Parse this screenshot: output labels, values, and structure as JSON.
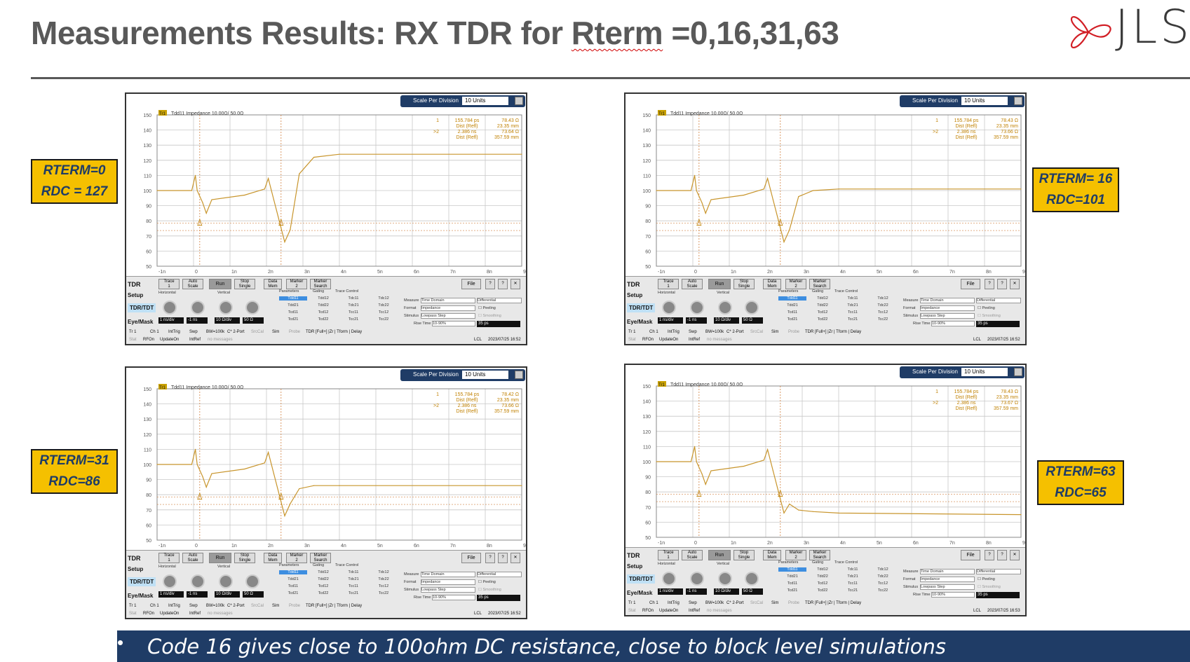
{
  "slide": {
    "title_prefix": "Measurements Results: RX TDR for ",
    "title_rterm": "Rterm",
    "title_suffix": " =0,16,31,63",
    "logo_text": "JLSe",
    "bullet": "•",
    "footer": "Code 16 gives close to 100ohm DC resistance, close to block level simulations"
  },
  "labels": [
    {
      "line1": "RTERM=0",
      "line2": "RDC = 127"
    },
    {
      "line1": "RTERM= 16",
      "line2": "RDC=101"
    },
    {
      "line1": "RTERM=31",
      "line2": "RDC=86"
    },
    {
      "line1": "RTERM=63",
      "line2": "RDC=65"
    }
  ],
  "panel_common": {
    "scale_label": "Scale Per Division",
    "scale_value": "10 Units",
    "trace_label": "Tr1",
    "trace_title": "Tdd11 Impedance 10.00Ω/  50.0Ω",
    "mk1": "1",
    "mk2": ">2",
    "mk1_t": "155.784  ps",
    "mk_dist": "Dist (Refl)",
    "mk1_d": "23.35 mm",
    "mk2_t": "2.386  ns",
    "mk2_d": "357.59 mm",
    "y_ticks": [
      "150",
      "140",
      "130",
      "120",
      "110",
      "100",
      "90",
      "80",
      "70",
      "60",
      "50"
    ],
    "x_ticks": [
      "-1n",
      "0",
      "1n",
      "2n",
      "3n",
      "4n",
      "5n",
      "6n",
      "7n",
      "8n",
      "9n"
    ],
    "side_tdr": "TDR",
    "side_setup": "Setup",
    "side_tdrtdt": "TDR/TDT",
    "side_eyemask": "Eye/Mask",
    "btn_trace": "Trace\n1",
    "btn_auto": "Auto\nScale",
    "btn_run": "Run",
    "btn_stop": "Stop\nSingle",
    "btn_data": "Data\nMem",
    "btn_marker": "Marker\n2",
    "btn_search": "Marker\nSearch",
    "btn_file": "File",
    "help": "?",
    "close": "✕",
    "horizontal": "Horizontal",
    "vertical": "Vertical",
    "hz_val": "1 ns/div",
    "hz_off": "-1 ns",
    "v_val": "10 Ω/div",
    "v_off": "50 Ω",
    "parameters": "Parameters",
    "gating": "Gating",
    "trace_control": "Trace Control",
    "p_rows": [
      [
        "Tdd11",
        "Tdd12",
        "Tdc11",
        "Tdc12"
      ],
      [
        "Tdd21",
        "Tdd22",
        "Tdc21",
        "Tdc22"
      ],
      [
        "Tcd11",
        "Tcd12",
        "Tcc11",
        "Tcc12"
      ],
      [
        "Tcd21",
        "Tcd22",
        "Tcc21",
        "Tcc22"
      ]
    ],
    "measure": "Measure",
    "format": "Format",
    "stimulus": "Stimulus",
    "rise_time": "Rise Time",
    "measure_v": "Time Domain",
    "format_v": "Impedance",
    "stimulus_v": "Lowpass Step",
    "rise_v": "10-90%",
    "diff": "Differential",
    "peeling": "Peeling",
    "smoothing": "Smoothing",
    "rise_ps": "35 ps",
    "status_row1": [
      "Tr 1",
      "Ch 1",
      "IntTrig",
      "Swp",
      "BW=100k",
      "C* 2-Port",
      "SrcCal",
      "Sim",
      "Probe",
      "TDR [Full+] |Zr | Tform | Delay"
    ],
    "status_row2": [
      "Stat",
      "RFOn",
      "UpdateOn",
      "IntRef",
      "no messages"
    ],
    "lcl": "LCL"
  },
  "panels": [
    {
      "mk1_v": "78.43 Ω",
      "mk2_v": "73.64 Ω",
      "timestamp": "2023/07/25 16:52"
    },
    {
      "mk1_v": "78.43 Ω",
      "mk2_v": "73.66 Ω",
      "timestamp": "2023/07/25 16:52"
    },
    {
      "mk1_v": "78.42 Ω",
      "mk2_v": "73.66 Ω",
      "timestamp": "2023/07/25 16:52"
    },
    {
      "mk1_v": "78.43 Ω",
      "mk2_v": "73.67 Ω",
      "timestamp": "2023/07/25 16:53"
    }
  ],
  "chart_data": [
    {
      "type": "line",
      "title": "Tdd11 Impedance 10.00Ω/  50.0Ω",
      "xlabel": "",
      "ylabel": "",
      "xlim": [
        -1,
        9
      ],
      "ylim": [
        50,
        150
      ],
      "series": [
        {
          "x": [
            -1,
            -0.05,
            0.05,
            0.1,
            0.25,
            0.35,
            0.5,
            1.4,
            1.95,
            2.05,
            2.2,
            2.35,
            2.5,
            2.65,
            2.9,
            3.3,
            4,
            9
          ],
          "values": [
            100,
            100,
            110,
            100,
            92,
            85,
            94,
            97,
            101,
            108,
            94,
            80,
            66,
            74,
            111,
            122,
            124,
            124
          ]
        }
      ]
    },
    {
      "type": "line",
      "title": "Tdd11 Impedance 10.00Ω/  50.0Ω",
      "xlabel": "",
      "ylabel": "",
      "xlim": [
        -1,
        9
      ],
      "ylim": [
        50,
        150
      ],
      "series": [
        {
          "x": [
            -1,
            -0.05,
            0.05,
            0.1,
            0.25,
            0.35,
            0.5,
            1.4,
            1.95,
            2.05,
            2.2,
            2.35,
            2.5,
            2.65,
            2.9,
            3.3,
            4,
            9
          ],
          "values": [
            100,
            100,
            110,
            100,
            92,
            85,
            94,
            97,
            101,
            108,
            94,
            80,
            66,
            74,
            96,
            100,
            101,
            101
          ]
        }
      ]
    },
    {
      "type": "line",
      "title": "Tdd11 Impedance 10.00Ω/  50.0Ω",
      "xlabel": "",
      "ylabel": "",
      "xlim": [
        -1,
        9
      ],
      "ylim": [
        50,
        150
      ],
      "series": [
        {
          "x": [
            -1,
            -0.05,
            0.05,
            0.1,
            0.25,
            0.35,
            0.5,
            1.4,
            1.95,
            2.05,
            2.2,
            2.35,
            2.5,
            2.65,
            2.9,
            3.3,
            4,
            9
          ],
          "values": [
            100,
            100,
            110,
            100,
            92,
            85,
            94,
            97,
            101,
            108,
            94,
            80,
            66,
            74,
            84,
            86,
            86,
            86
          ]
        }
      ]
    },
    {
      "type": "line",
      "title": "Tdd11 Impedance 10.00Ω/  50.0Ω",
      "xlabel": "",
      "ylabel": "",
      "xlim": [
        -1,
        9
      ],
      "ylim": [
        50,
        150
      ],
      "series": [
        {
          "x": [
            -1,
            -0.05,
            0.05,
            0.1,
            0.25,
            0.35,
            0.5,
            1.4,
            1.95,
            2.05,
            2.2,
            2.35,
            2.5,
            2.65,
            2.9,
            3.3,
            4,
            9
          ],
          "values": [
            100,
            100,
            110,
            100,
            92,
            85,
            94,
            97,
            101,
            108,
            94,
            80,
            66,
            72,
            68,
            67,
            66,
            65
          ]
        }
      ]
    }
  ]
}
